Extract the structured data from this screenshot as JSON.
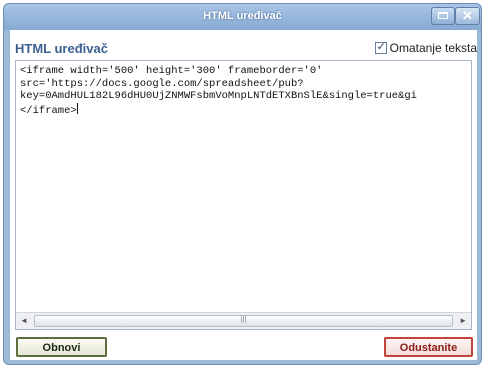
{
  "window": {
    "title": "HTML uređivač",
    "close_glyph": "✕"
  },
  "header": {
    "heading": "HTML uređivač",
    "wrap_label": "Omatanje teksta",
    "wrap_checked": true,
    "check_glyph": "✓"
  },
  "editor": {
    "lines": [
      "<iframe width='500' height='300' frameborder='0'",
      "src='https://docs.google.com/spreadsheet/pub?",
      "key=0AmdHUL182L96dHU0UjZNMWFsbmVoMnpLNTdETXBnSlE&single=true&gi",
      "</iframe>"
    ]
  },
  "scrollbar": {
    "left_arrow": "◄",
    "right_arrow": "►",
    "grip": "|||"
  },
  "buttons": {
    "refresh": "Obnovi",
    "cancel": "Odustanite"
  },
  "colors": {
    "title_bar": "#86a9d2",
    "heading": "#3c5f93",
    "cancel_border": "#c2443c"
  }
}
